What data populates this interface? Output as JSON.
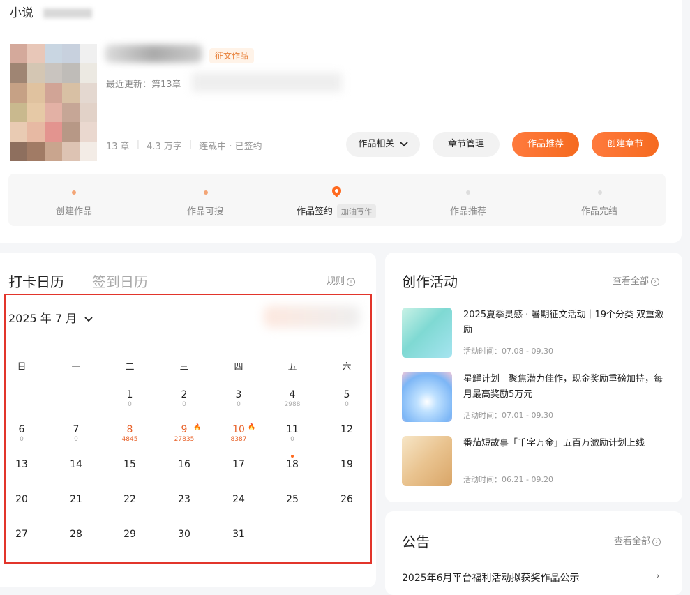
{
  "work": {
    "breadcrumb": "小说",
    "tag": "征文作品",
    "update_label": "最近更新：第13章",
    "chapters": "13 章",
    "words": "4.3 万字",
    "status": "连载中 · 已签约",
    "buttons": {
      "related": "作品相关",
      "chapter_manage": "章节管理",
      "recommend": "作品推荐",
      "create_chapter": "创建章节"
    },
    "steps": [
      "创建作品",
      "作品可搜",
      "作品签约",
      "作品推荐",
      "作品完结"
    ],
    "step_pill": "加油写作"
  },
  "calendar": {
    "tab_active": "打卡日历",
    "tab_inactive": "签到日历",
    "rules": "规则",
    "month": "2025 年 7 月",
    "weekdays": [
      "日",
      "一",
      "二",
      "三",
      "四",
      "五",
      "六"
    ],
    "days": [
      {
        "n": "1",
        "s": "0"
      },
      {
        "n": "2",
        "s": "0"
      },
      {
        "n": "3",
        "s": "0"
      },
      {
        "n": "4",
        "s": "2988"
      },
      {
        "n": "5",
        "s": "0"
      },
      {
        "n": "6",
        "s": "0"
      },
      {
        "n": "7",
        "s": "0"
      },
      {
        "n": "8",
        "s": "4845"
      },
      {
        "n": "9",
        "s": "27835"
      },
      {
        "n": "10",
        "s": "8387"
      },
      {
        "n": "11",
        "s": "0"
      },
      {
        "n": "12",
        "s": ""
      },
      {
        "n": "13"
      },
      {
        "n": "14"
      },
      {
        "n": "15"
      },
      {
        "n": "16"
      },
      {
        "n": "17"
      },
      {
        "n": "18"
      },
      {
        "n": "19"
      },
      {
        "n": "20"
      },
      {
        "n": "21"
      },
      {
        "n": "22"
      },
      {
        "n": "23"
      },
      {
        "n": "24"
      },
      {
        "n": "25"
      },
      {
        "n": "26"
      },
      {
        "n": "27"
      },
      {
        "n": "28"
      },
      {
        "n": "29"
      },
      {
        "n": "30"
      },
      {
        "n": "31"
      }
    ],
    "hot_days": [
      "8",
      "9",
      "10"
    ],
    "flame_days": [
      "9",
      "10"
    ]
  },
  "activities": {
    "title": "创作活动",
    "see_all": "查看全部",
    "items": [
      {
        "title": "2025夏季灵感 · 暑期征文活动｜19个分类 双重激励",
        "time": "活动时间：07.08 - 09.30"
      },
      {
        "title": "星耀计划｜聚焦潜力佳作，现金奖励重磅加持，每月最高奖励5万元",
        "time": "活动时间：07.01 - 09.30"
      },
      {
        "title": "番茄短故事「千字万金」五百万激励计划上线",
        "time": "活动时间：06.21 - 09.20"
      }
    ]
  },
  "notice": {
    "title": "公告",
    "see_all": "查看全部",
    "first_item": "2025年6月平台福利活动拟获奖作品公示"
  },
  "colors": {
    "accent": "#ff6a1f",
    "frame": "#e2352b"
  }
}
